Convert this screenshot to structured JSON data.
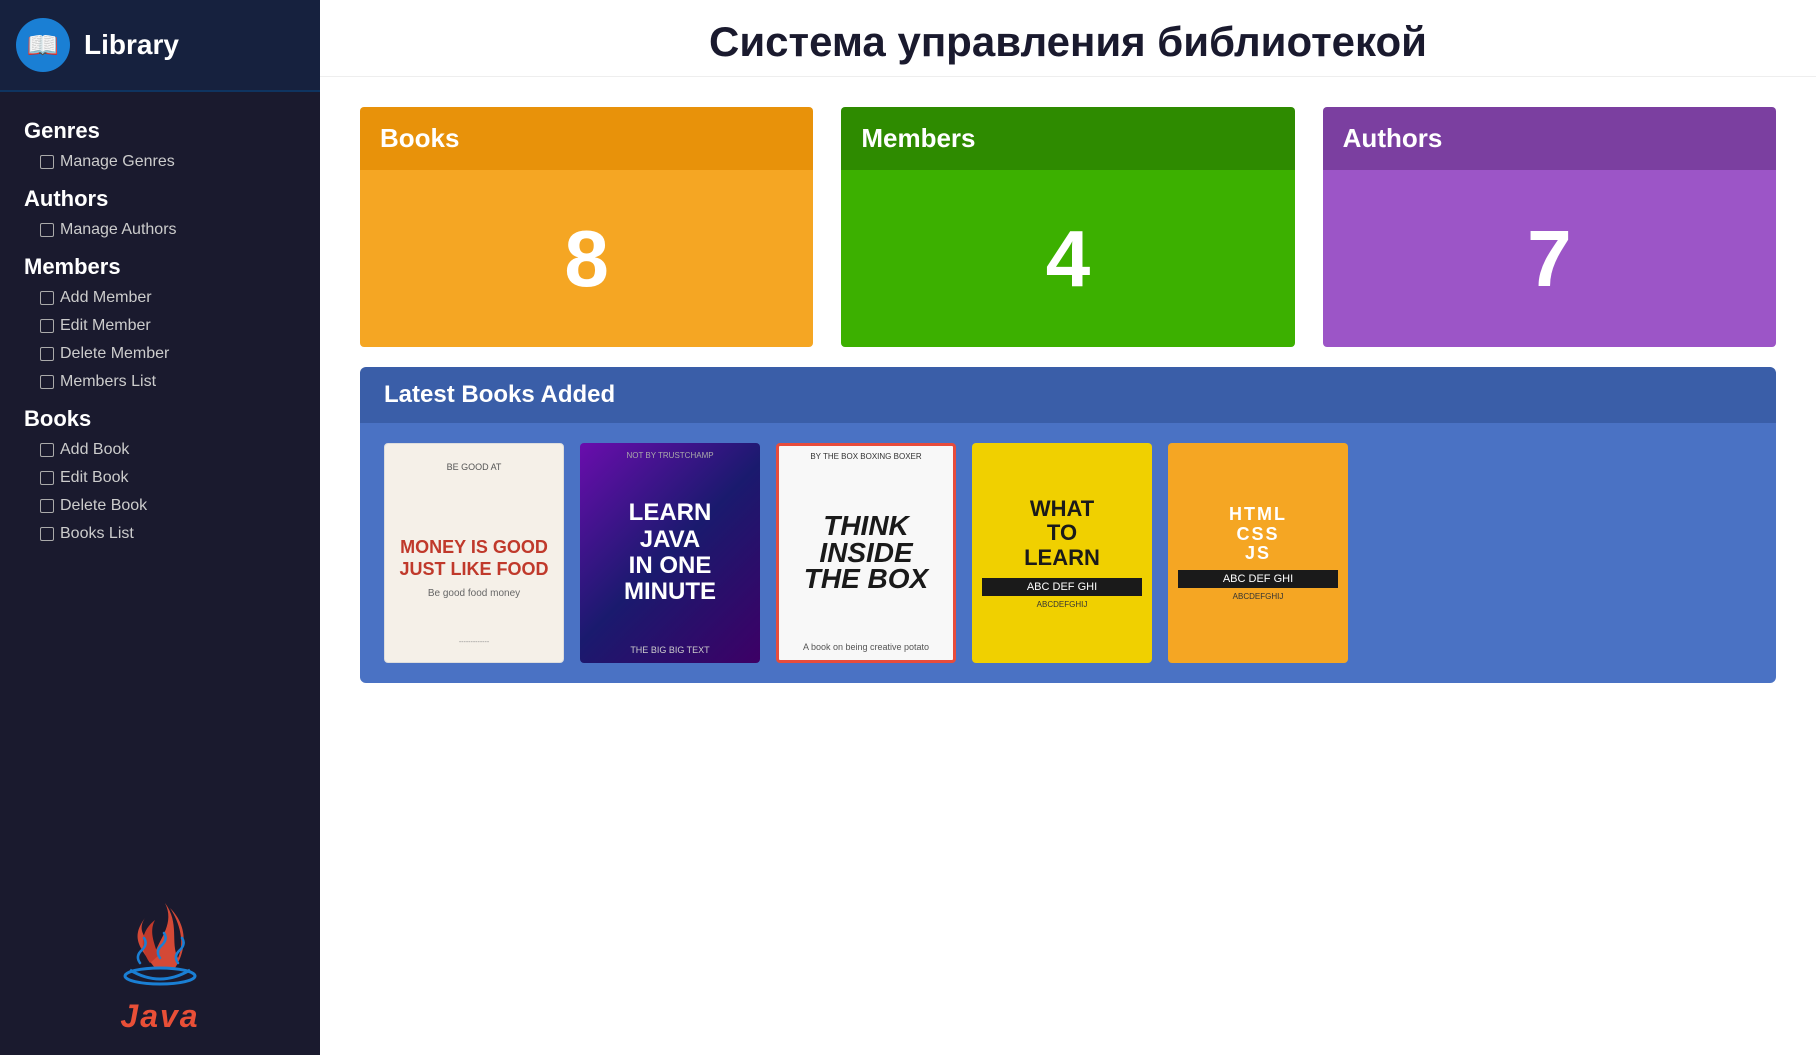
{
  "app": {
    "logo_icon": "📖",
    "logo_text": "Library",
    "main_title": "Система управления библиотекой"
  },
  "sidebar": {
    "categories": [
      {
        "label": "Genres",
        "items": [
          "Manage Genres"
        ]
      },
      {
        "label": "Authors",
        "items": [
          "Manage Authors"
        ]
      },
      {
        "label": "Members",
        "items": [
          "Add Member",
          "Edit Member",
          "Delete Member",
          "Members List"
        ]
      },
      {
        "label": "Books",
        "items": [
          "Add Book",
          "Edit Book",
          "Delete Book",
          "Books List"
        ]
      }
    ],
    "footer_label": "Java"
  },
  "stats": [
    {
      "label": "Books",
      "value": "8"
    },
    {
      "label": "Members",
      "value": "4"
    },
    {
      "label": "Authors",
      "value": "7"
    }
  ],
  "latest_books": {
    "section_title": "Latest Books Added",
    "books": [
      {
        "title": "MONEY IS GOOD JUST LIKE FOOD",
        "subtitle": "Be good food money",
        "style": "book-1"
      },
      {
        "not_by": "NOT BY TRUSTCHAMP",
        "title": "LEARN JAVA IN ONE MINUTE",
        "bottom": "THE BIG BIG TEXT",
        "style": "book-2"
      },
      {
        "by": "BY THE BOX BOXING BOXER",
        "title": "THINK INSIDE THE BOX",
        "sub": "A book on being creative potato",
        "style": "book-3"
      },
      {
        "title": "WHAT TO LEARN",
        "bar": "ABC DEF GHI",
        "subtitle": "ABCDEFGHIJ",
        "style": "book-4"
      },
      {
        "lines": [
          "HTML",
          "CSS",
          "JS"
        ],
        "bar": "ABC DEF GHI",
        "subtitle": "ABCDEFGHIJ",
        "style": "book-5"
      }
    ]
  }
}
